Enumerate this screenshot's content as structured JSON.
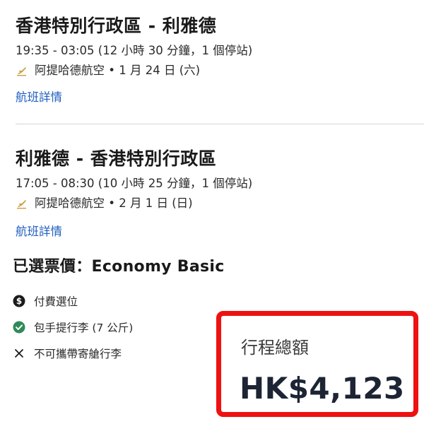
{
  "outbound": {
    "route": "香港特別行政區 - 利雅德",
    "times": "19:35 - 03:05 (12 小時 30 分鐘，1 個停站)",
    "airline_date": "阿提哈德航空 • 1 月 24 日 (六)",
    "details_link": "航班詳情"
  },
  "return": {
    "route": "利雅德 - 香港特別行政區",
    "times": "17:05 - 08:30 (10 小時 25 分鐘，1 個停站)",
    "airline_date": "阿提哈德航空 • 2 月 1 日 (日)",
    "details_link": "航班詳情"
  },
  "fare": {
    "title": "已選票價：Economy Basic",
    "features": [
      {
        "label": "付費選位",
        "icon": "dollar-circle-icon"
      },
      {
        "label": "包手提行李 (7 公斤)",
        "icon": "check-circle-icon"
      },
      {
        "label": "不可攜帶寄艙行李",
        "icon": "x-icon"
      }
    ]
  },
  "total": {
    "label": "行程總額",
    "value": "HK$4,123"
  },
  "colors": {
    "link": "#1f5fbf",
    "check_green": "#2e8b57",
    "highlight_red": "#ee1111",
    "airline_gold": "#c8a040"
  }
}
